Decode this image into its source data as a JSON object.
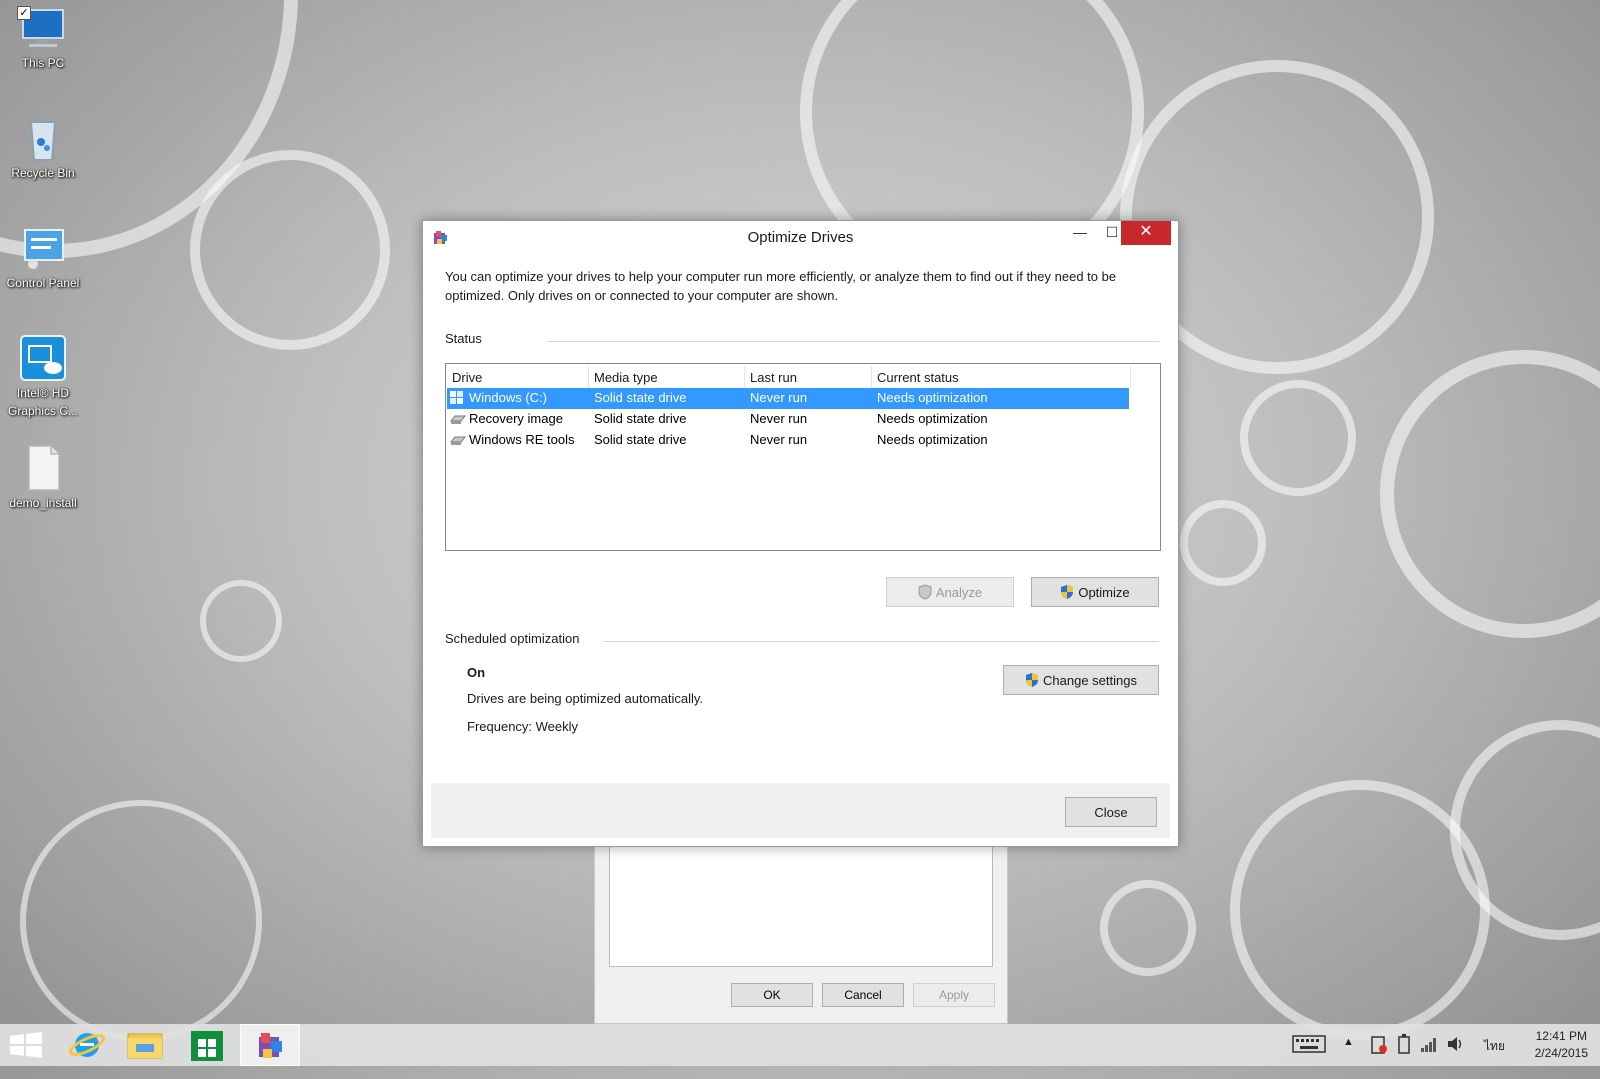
{
  "desktop": {
    "icons": [
      {
        "label": "This PC",
        "icon": "this-pc-icon"
      },
      {
        "label": "Recycle Bin",
        "icon": "recycle-bin-icon"
      },
      {
        "label": "Control Panel",
        "icon": "control-panel-icon"
      },
      {
        "label": "Intel® HD Graphics C...",
        "icon": "intel-graphics-icon"
      },
      {
        "label": "demo_install",
        "icon": "file-icon"
      }
    ]
  },
  "back_dialog": {
    "ok": "OK",
    "cancel": "Cancel",
    "apply": "Apply"
  },
  "dialog": {
    "title": "Optimize Drives",
    "minimize": "—",
    "maximize": "☐",
    "close_glyph": "✕",
    "description": "You can optimize your drives to help your computer run more efficiently, or analyze them to find out if they need to be optimized. Only drives on or connected to your computer are shown.",
    "status_label": "Status",
    "columns": [
      "Drive",
      "Media type",
      "Last run",
      "Current status"
    ],
    "drives": [
      {
        "name": "Windows (C:)",
        "media": "Solid state drive",
        "last_run": "Never run",
        "status": "Needs optimization"
      },
      {
        "name": "Recovery image",
        "media": "Solid state drive",
        "last_run": "Never run",
        "status": "Needs optimization"
      },
      {
        "name": "Windows RE tools",
        "media": "Solid state drive",
        "last_run": "Never run",
        "status": "Needs optimization"
      }
    ],
    "analyze": "Analyze",
    "optimize": "Optimize",
    "scheduled_label": "Scheduled optimization",
    "schedule_state": "On",
    "schedule_desc": "Drives are being optimized automatically.",
    "frequency": "Frequency: Weekly",
    "change_settings": "Change settings",
    "close_button": "Close"
  },
  "taskbar": {
    "clock_time": "12:41 PM",
    "clock_date": "2/24/2015",
    "language": "ไทย"
  },
  "colors": {
    "selection": "#3399ff",
    "close_red": "#c7282c"
  }
}
